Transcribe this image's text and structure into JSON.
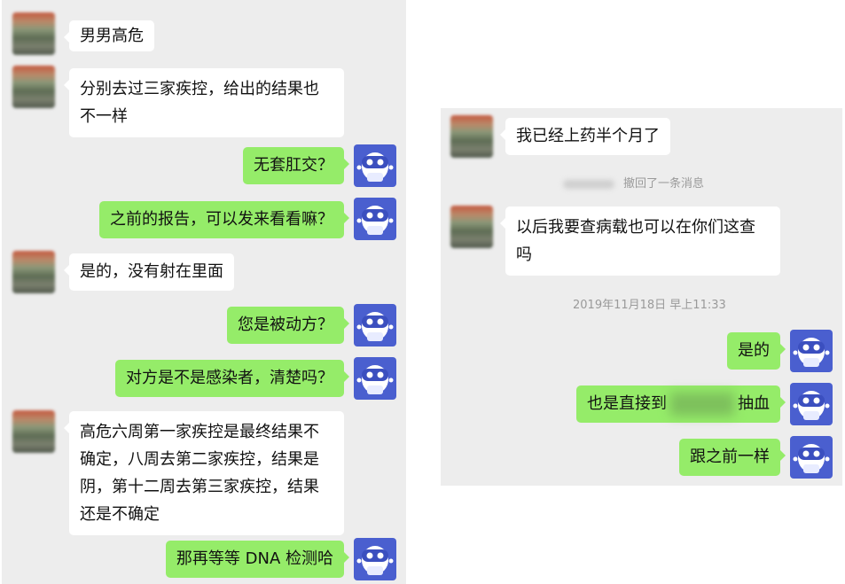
{
  "left_chat": {
    "messages": [
      {
        "side": "in",
        "text": "男男高危"
      },
      {
        "side": "in",
        "lines": [
          "分别去过三家疾控，给出的结果也",
          "不一样"
        ]
      },
      {
        "side": "out",
        "text": "无套肛交？"
      },
      {
        "side": "out",
        "text": "之前的报告，可以发来看看嘛？"
      },
      {
        "side": "in",
        "text": "是的，没有射在里面"
      },
      {
        "side": "out",
        "text": "您是被动方？"
      },
      {
        "side": "out",
        "text": "对方是不是感染者，清楚吗？"
      },
      {
        "side": "in",
        "lines": [
          "高危六周第一家疾控是最终结果不",
          "确定，八周去第二家疾控，结果是",
          "阴，第十二周去第三家疾控，结果",
          "还是不确定"
        ]
      },
      {
        "side": "out",
        "text": "那再等等 DNA 检测哈"
      }
    ]
  },
  "right_chat": {
    "messages": [
      {
        "side": "in",
        "text": "我已经上药半个月了"
      },
      {
        "side": "in",
        "lines": [
          "以后我要查病载也可以在你们这查",
          "吗"
        ]
      },
      {
        "side": "out",
        "text": "是的"
      },
      {
        "side": "out",
        "text_before": "也是直接到",
        "text_after": "抽血"
      },
      {
        "side": "out",
        "text": "跟之前一样"
      }
    ],
    "recall_notice": "撤回了一条消息",
    "timestamp": "2019年11月18日 早上11:33"
  },
  "icons": {
    "user_avatar": "blurred-photo-avatar",
    "bot_avatar": "robot-mascot-icon"
  },
  "colors": {
    "panel_bg": "#ededed",
    "incoming_bubble": "#ffffff",
    "outgoing_bubble": "#95ec69",
    "bot_avatar_bg": "#4a5fcf"
  }
}
